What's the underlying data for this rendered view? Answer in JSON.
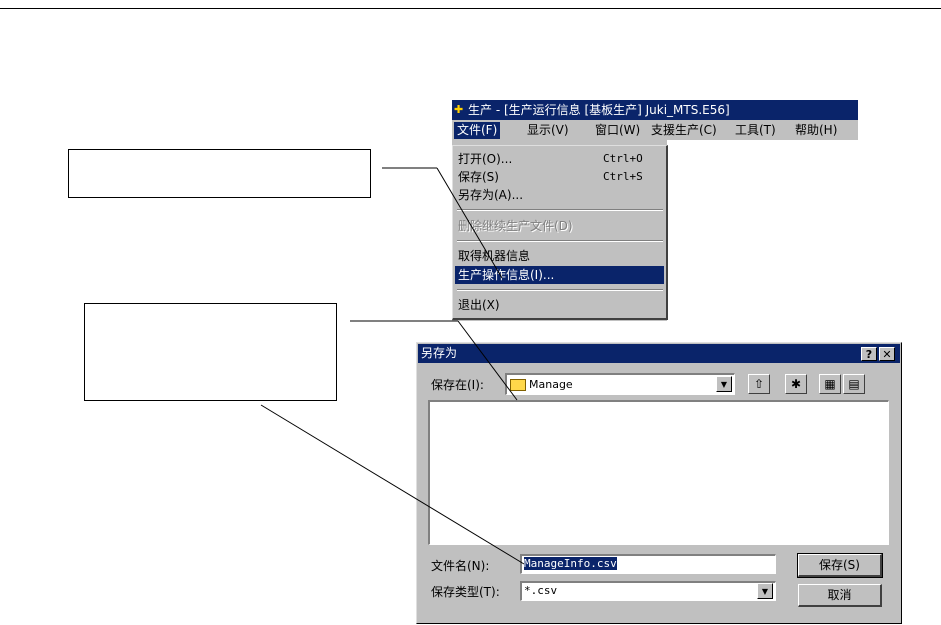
{
  "app": {
    "title": "生产 - [生产运行信息 [基板生产] Juki_MTS.E56]",
    "menu": [
      {
        "label": "文件(F)"
      },
      {
        "label": "显示(V)"
      },
      {
        "label": "窗口(W)"
      },
      {
        "label": "支援生产(C)"
      },
      {
        "label": "工具(T)"
      },
      {
        "label": "帮助(H)"
      }
    ]
  },
  "file_menu": {
    "open": {
      "label": "打开(O)...",
      "shortcut": "Ctrl+O"
    },
    "save": {
      "label": "保存(S)",
      "shortcut": "Ctrl+S"
    },
    "save_as": {
      "label": "另存为(A)..."
    },
    "delete_continue": {
      "label": "删除继续生产文件(D)"
    },
    "get_machine_info": {
      "label": "取得机器信息"
    },
    "production_ops_info": {
      "label": "生产操作信息(I)..."
    },
    "exit": {
      "label": "退出(X)"
    }
  },
  "dialog": {
    "title": "另存为",
    "help_btn": "?",
    "close_btn": "✕",
    "save_in_label": "保存在(I):",
    "save_in_value": "Manage",
    "filename_label": "文件名(N):",
    "filename_value": "ManageInfo.csv",
    "filetype_label": "保存类型(T):",
    "filetype_value": "*.csv",
    "save_button": "保存(S)",
    "cancel_button": "取消"
  },
  "icons": {
    "app": "app-icon",
    "folder": "folder-icon",
    "up_folder": "up-folder-icon",
    "new_folder": "new-folder-icon",
    "list_view": "list-view-icon",
    "details_view": "details-view-icon",
    "dropdown_arrow": "chevron-down-icon"
  },
  "colors": {
    "titlebar": "#0a246a",
    "face": "#c0c0c0",
    "selection": "#0a246a"
  }
}
